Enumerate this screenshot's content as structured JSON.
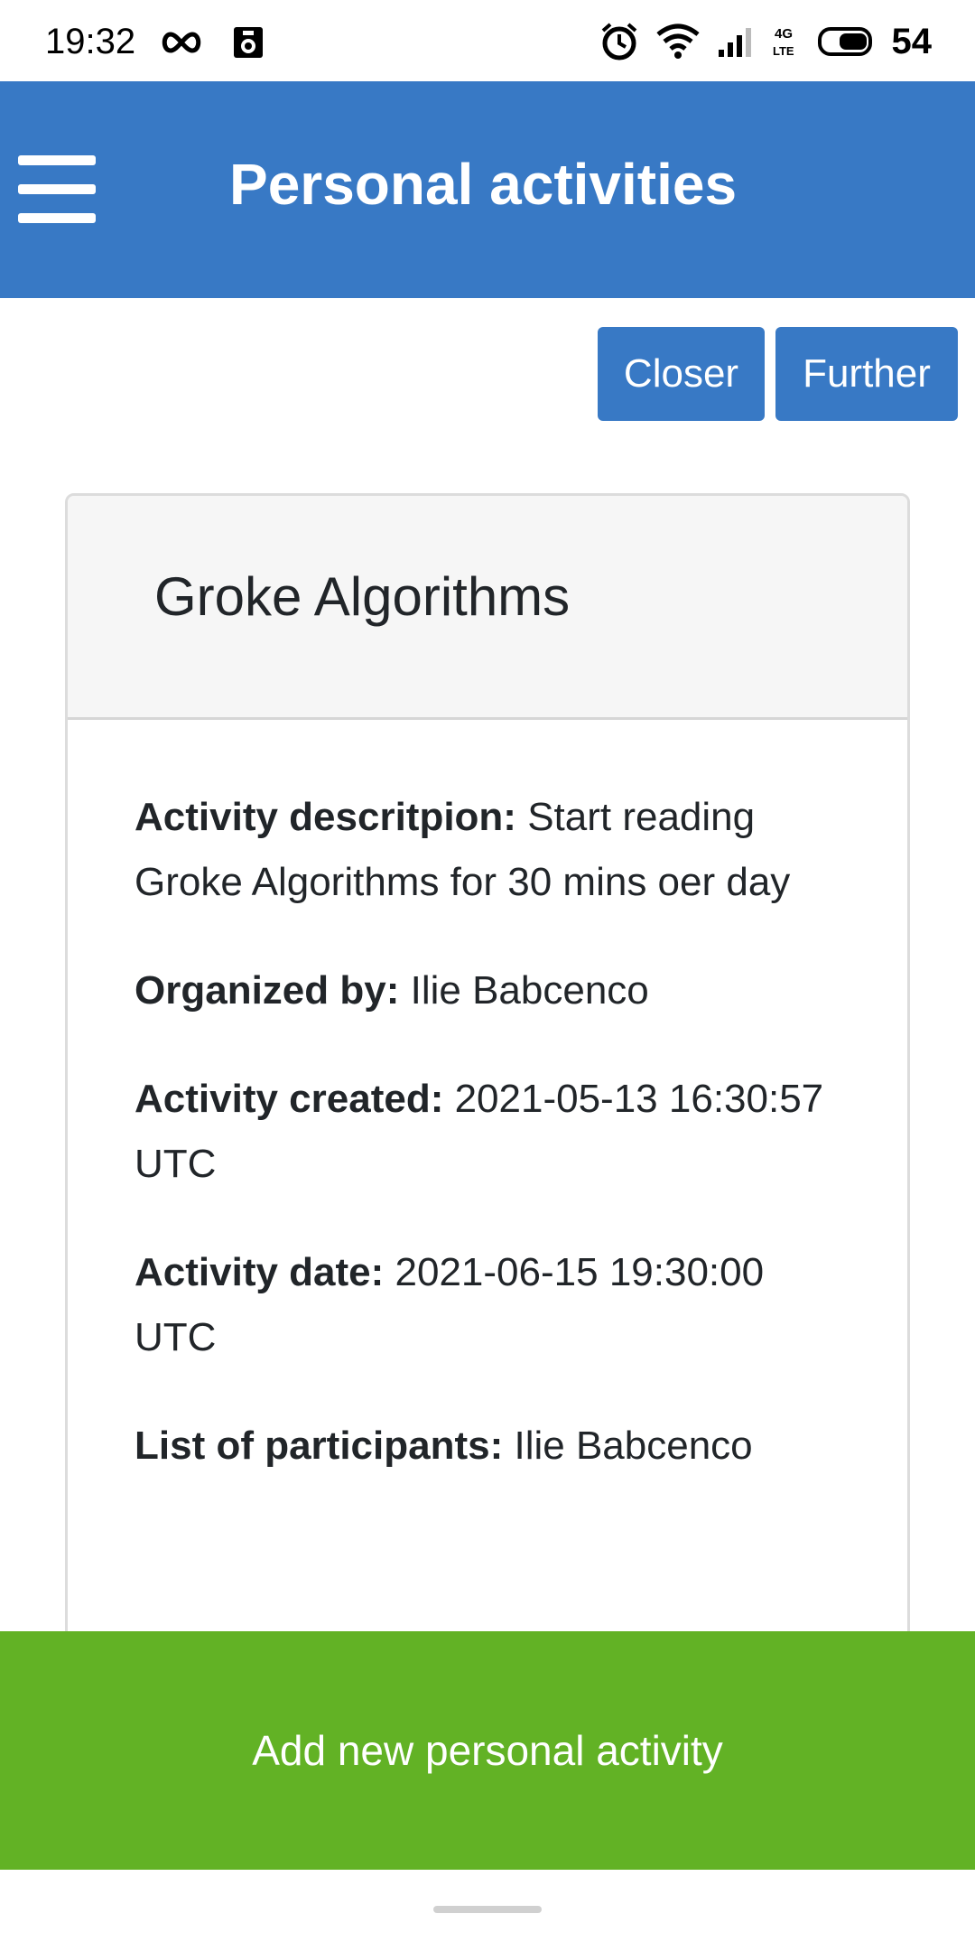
{
  "status_bar": {
    "time": "19:32",
    "battery": "54",
    "icons": [
      "infinity-icon",
      "photo-icon",
      "alarm-icon",
      "wifi-icon",
      "signal-icon",
      "4g-lte-icon",
      "battery-icon"
    ]
  },
  "app_bar": {
    "title": "Personal activities",
    "menu_icon": "hamburger-menu-icon"
  },
  "nav": {
    "closer_label": "Closer",
    "further_label": "Further"
  },
  "activity": {
    "title": "Groke Algorithms",
    "description_label": "Activity descritpion:",
    "description_value": " Start reading Groke Algorithms for 30 mins oer day",
    "organizer_label": "Organized by:",
    "organizer_value": " Ilie Babcenco",
    "created_label": "Activity created:",
    "created_value": " 2021-05-13 16:30:57 UTC",
    "date_label": "Activity date:",
    "date_value": " 2021-06-15 19:30:00 UTC",
    "participants_label": "List of participants:",
    "participants_value": " Ilie Babcenco"
  },
  "actions": {
    "add_label": "Add new personal activity"
  },
  "colors": {
    "primary": "#3879c5",
    "success": "#62b225",
    "card_header_bg": "#f6f6f6"
  }
}
